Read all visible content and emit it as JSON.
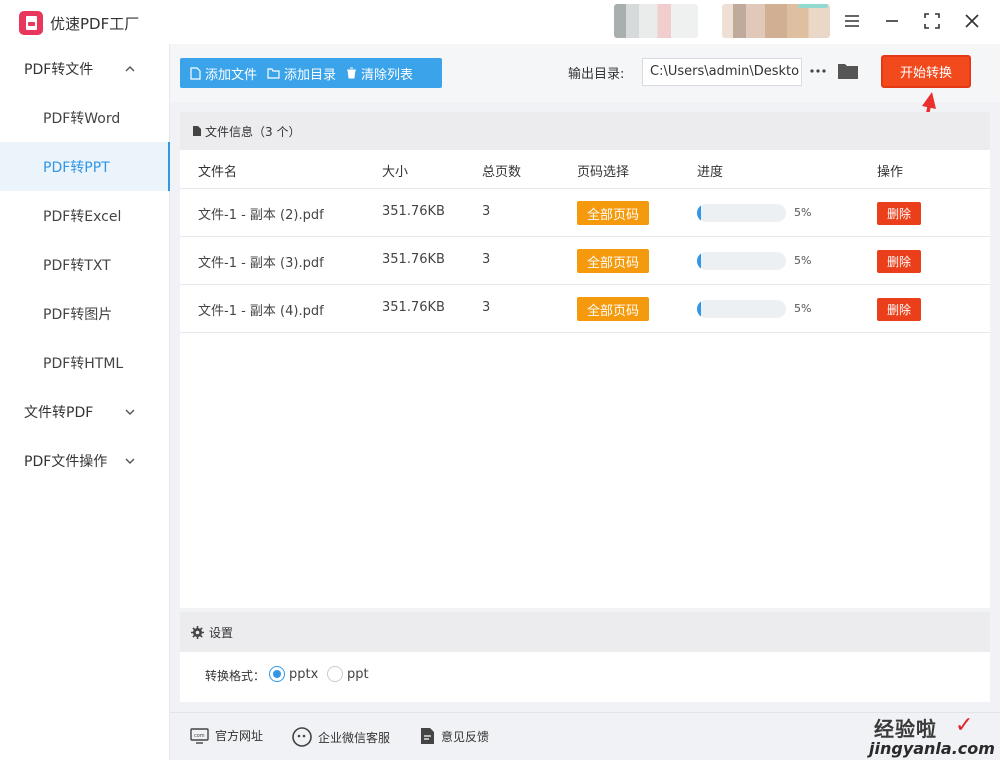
{
  "app": {
    "title": "优速PDF工厂"
  },
  "sidebar": {
    "groups": [
      {
        "label": "PDF转文件"
      },
      {
        "label": "文件转PDF"
      },
      {
        "label": "PDF文件操作"
      }
    ],
    "items": [
      {
        "label": "PDF转Word"
      },
      {
        "label": "PDF转PPT",
        "active": true
      },
      {
        "label": "PDF转Excel"
      },
      {
        "label": "PDF转TXT"
      },
      {
        "label": "PDF转图片"
      },
      {
        "label": "PDF转HTML"
      }
    ]
  },
  "toolbar": {
    "add_file": "添加文件",
    "add_folder": "添加目录",
    "clear_list": "清除列表",
    "output_label": "输出目录:",
    "output_path": "C:\\Users\\admin\\Deskto",
    "start": "开始转换"
  },
  "file_panel": {
    "header": "文件信息（3 个）",
    "columns": [
      "文件名",
      "大小",
      "总页数",
      "页码选择",
      "进度",
      "操作"
    ],
    "rows": [
      {
        "name": "文件-1 - 副本 (2).pdf",
        "size": "351.76KB",
        "pages": "3",
        "page_select": "全部页码",
        "progress_text": "5%",
        "progress": 0.05,
        "action": "删除"
      },
      {
        "name": "文件-1 - 副本 (3).pdf",
        "size": "351.76KB",
        "pages": "3",
        "page_select": "全部页码",
        "progress_text": "5%",
        "progress": 0.05,
        "action": "删除"
      },
      {
        "name": "文件-1 - 副本 (4).pdf",
        "size": "351.76KB",
        "pages": "3",
        "page_select": "全部页码",
        "progress_text": "5%",
        "progress": 0.05,
        "action": "删除"
      }
    ]
  },
  "settings": {
    "title": "设置",
    "format_label": "转换格式：",
    "options": [
      {
        "label": "pptx",
        "checked": true
      },
      {
        "label": "ppt",
        "checked": false
      }
    ]
  },
  "footer": {
    "website": "官方网址",
    "wechat": "企业微信客服",
    "feedback": "意见反馈"
  },
  "watermark": {
    "cn": "经验啦",
    "en": "jingyanla.com",
    "check": "✓"
  },
  "colors": {
    "accent": "#3296e6",
    "toolbar_blue": "#3aa3ea",
    "start": "#f24a1d",
    "tag_orange": "#f59a0d",
    "delete_red": "#ea3f1a"
  }
}
